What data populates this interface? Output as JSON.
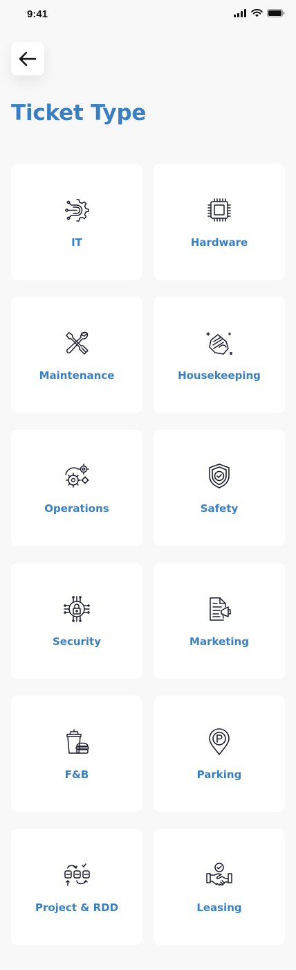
{
  "status_bar": {
    "time": "9:41"
  },
  "header": {
    "title": "Ticket Type"
  },
  "ticket_types": [
    {
      "label": "IT",
      "icon": "it-gear-icon"
    },
    {
      "label": "Hardware",
      "icon": "chip-icon"
    },
    {
      "label": "Maintenance",
      "icon": "wrench-screwdriver-icon"
    },
    {
      "label": "Housekeeping",
      "icon": "cleaning-hand-icon"
    },
    {
      "label": "Operations",
      "icon": "gears-icon"
    },
    {
      "label": "Safety",
      "icon": "shield-check-icon"
    },
    {
      "label": "Security",
      "icon": "lock-circuit-icon"
    },
    {
      "label": "Marketing",
      "icon": "document-megaphone-icon"
    },
    {
      "label": "F&B",
      "icon": "drink-burger-icon"
    },
    {
      "label": "Parking",
      "icon": "parking-pin-icon"
    },
    {
      "label": "Project & RDD",
      "icon": "workflow-icon"
    },
    {
      "label": "Leasing",
      "icon": "handshake-icon"
    }
  ],
  "colors": {
    "accent": "#3a7fc2",
    "background": "#f8f8f8",
    "card": "#ffffff",
    "icon": "#1c1c2e"
  }
}
